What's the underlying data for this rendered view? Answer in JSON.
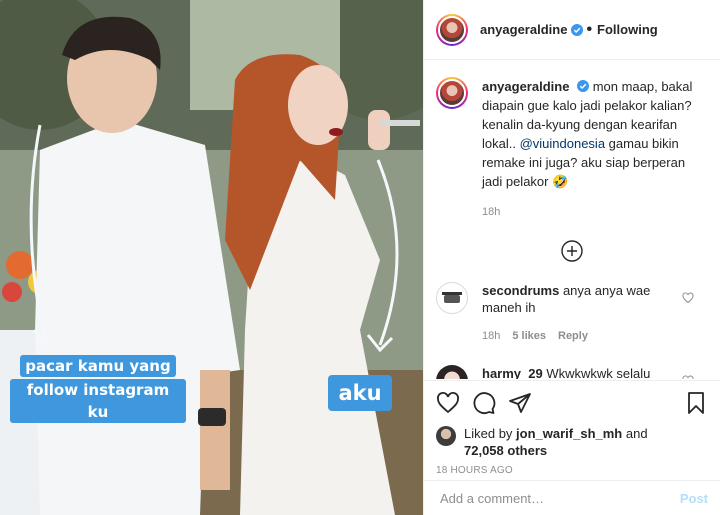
{
  "photo": {
    "tag_left_line1": "pacar kamu yang",
    "tag_left_line2": "follow instagram ku",
    "tag_right": "aku",
    "tag_color": "#3f98dd"
  },
  "header": {
    "username": "anyageraldine",
    "separator": "•",
    "follow_label": "Following"
  },
  "caption": {
    "username": "anyageraldine",
    "text_before": "mon maap, bakal diapain gue kalo jadi pelakor kalian? kenalin da-kyung dengan kearifan lokal.. ",
    "mention": "@viuindonesia",
    "text_after": " gamau bikin remake ini juga? aku siap berperan jadi pelakor 🤣",
    "age": "18h"
  },
  "comments": [
    {
      "username": "secondrums",
      "text": "anya anya wae maneh ih",
      "age": "18h",
      "likes": "5 likes",
      "reply": "Reply"
    },
    {
      "username": "harmy_29",
      "text": "Wkwkwkwk selalu receh 😂😂"
    }
  ],
  "liked_by": {
    "prefix": "Liked by ",
    "user": "jon_warif_sh_mh",
    "middle": " and",
    "others": "72,058 others"
  },
  "time_ago": "18 HOURS AGO",
  "add_comment": {
    "placeholder": "Add a comment…",
    "post_label": "Post"
  },
  "colors": {
    "verified": "#3897f0",
    "link": "#00376b",
    "post_disabled": "#b2dffc"
  }
}
